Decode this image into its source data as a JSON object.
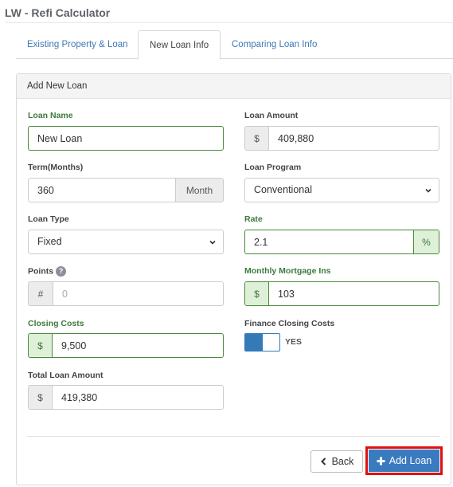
{
  "app": {
    "title": "LW - Refi Calculator"
  },
  "tabs": [
    {
      "label": "Existing Property & Loan",
      "active": false
    },
    {
      "label": "New Loan Info",
      "active": true
    },
    {
      "label": "Comparing Loan Info",
      "active": false
    }
  ],
  "panel": {
    "title": "Add New Loan"
  },
  "form": {
    "loan_name": {
      "label": "Loan Name",
      "value": "New Loan"
    },
    "loan_amount": {
      "label": "Loan Amount",
      "prefix": "$",
      "value": "409,880"
    },
    "term": {
      "label": "Term(Months)",
      "value": "360",
      "suffix": "Month"
    },
    "loan_program": {
      "label": "Loan Program",
      "value": "Conventional"
    },
    "loan_type": {
      "label": "Loan Type",
      "value": "Fixed"
    },
    "rate": {
      "label": "Rate",
      "value": "2.1",
      "suffix": "%"
    },
    "points": {
      "label": "Points",
      "help": "?",
      "prefix": "#",
      "placeholder": "0"
    },
    "monthly_mortgage_ins": {
      "label": "Monthly Mortgage Ins",
      "prefix": "$",
      "value": "103"
    },
    "closing_costs": {
      "label": "Closing Costs",
      "prefix": "$",
      "value": "9,500"
    },
    "finance_closing_costs": {
      "label": "Finance Closing Costs",
      "toggle_text": "YES",
      "on": true
    },
    "total_loan_amount": {
      "label": "Total Loan Amount",
      "prefix": "$",
      "value": "419,380"
    }
  },
  "buttons": {
    "back_label": "Back",
    "add_label": "Add Loan"
  },
  "colors": {
    "accent": "#3a7bc0",
    "valid": "#4a8a3a",
    "highlight": "#e01010"
  }
}
